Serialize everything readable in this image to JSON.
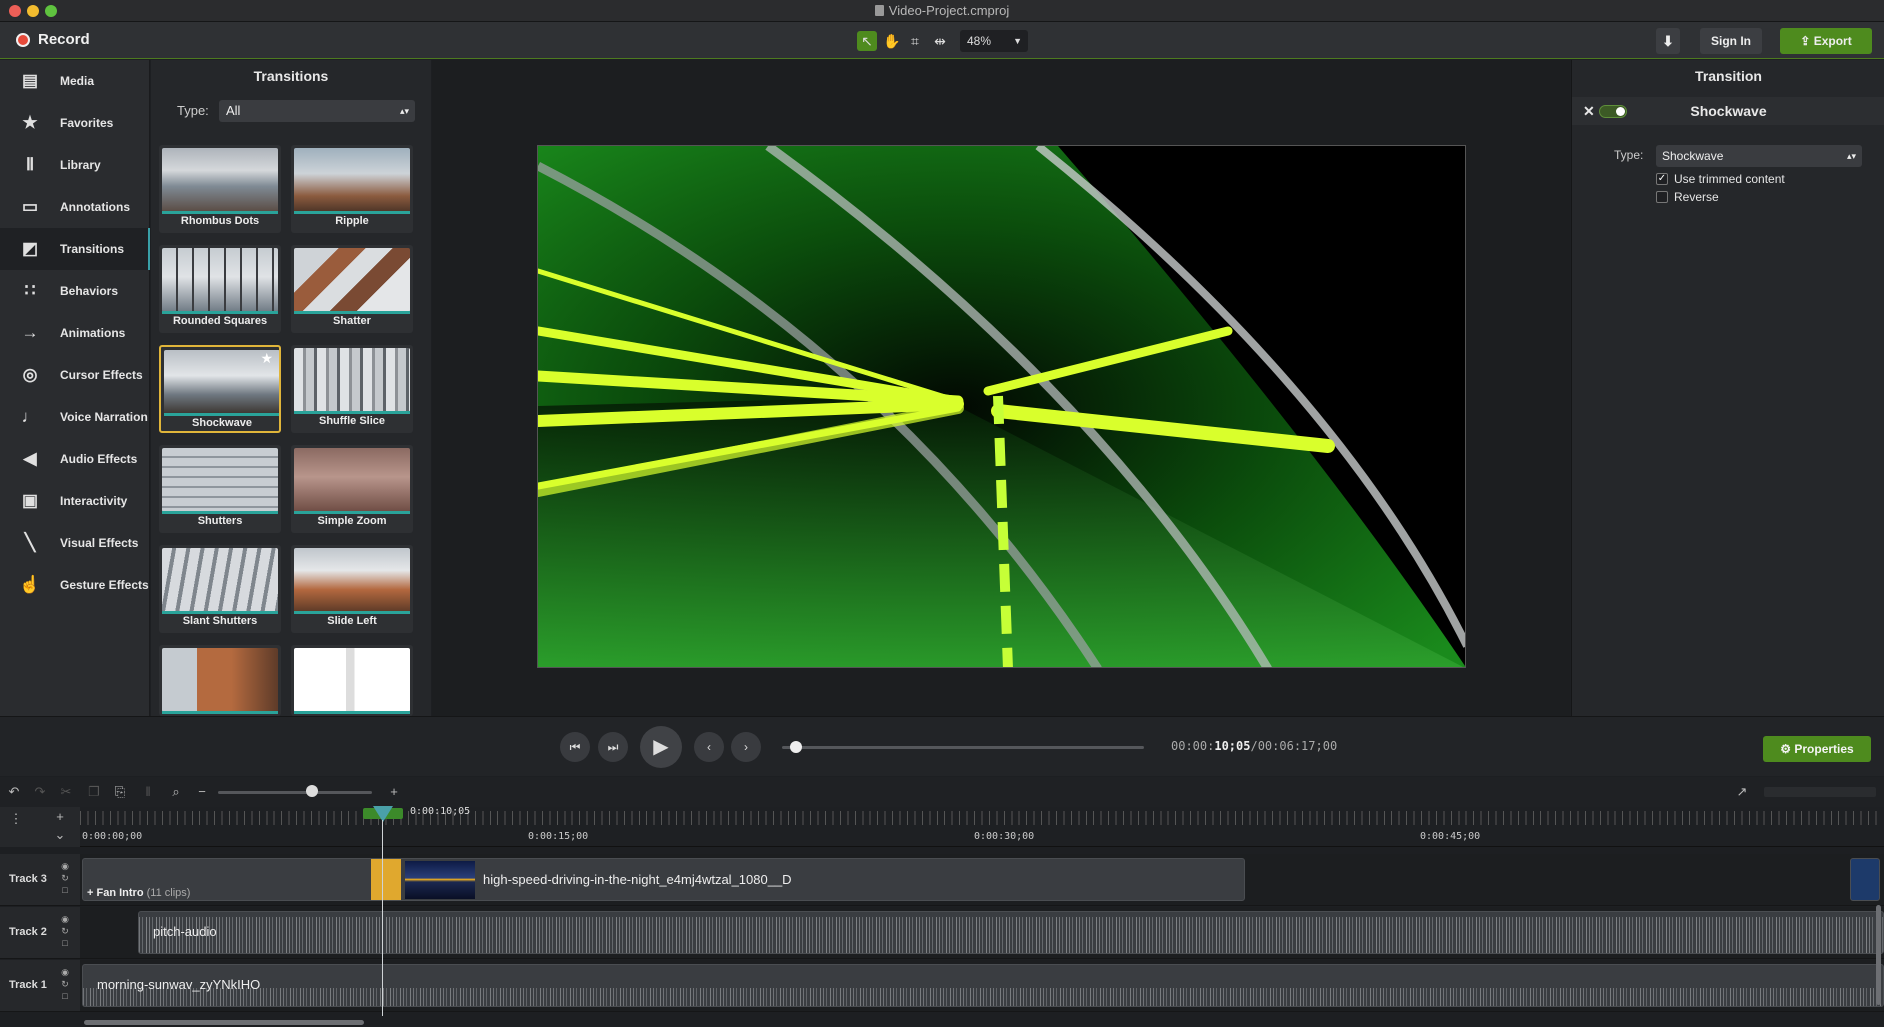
{
  "window": {
    "title": "Video-Project.cmproj"
  },
  "toolbar": {
    "record_label": "Record",
    "zoom": "48%",
    "sign_in": "Sign In",
    "export": "Export"
  },
  "nav": {
    "items": [
      {
        "label": "Media",
        "icon": "film-icon"
      },
      {
        "label": "Favorites",
        "icon": "star-icon"
      },
      {
        "label": "Library",
        "icon": "library-icon"
      },
      {
        "label": "Annotations",
        "icon": "annotation-icon"
      },
      {
        "label": "Transitions",
        "icon": "transition-icon",
        "active": true
      },
      {
        "label": "Behaviors",
        "icon": "behaviors-icon"
      },
      {
        "label": "Animations",
        "icon": "animation-arrow-icon"
      },
      {
        "label": "Cursor Effects",
        "icon": "cursor-icon"
      },
      {
        "label": "Voice Narration",
        "icon": "microphone-icon"
      },
      {
        "label": "Audio Effects",
        "icon": "speaker-icon"
      },
      {
        "label": "Interactivity",
        "icon": "interactivity-icon"
      },
      {
        "label": "Visual Effects",
        "icon": "wand-icon"
      },
      {
        "label": "Gesture Effects",
        "icon": "hand-icon"
      }
    ]
  },
  "transitions": {
    "title": "Transitions",
    "type_label": "Type:",
    "type_value": "All",
    "items": [
      "Rhombus Dots",
      "Ripple",
      "Rounded Squares",
      "Shatter",
      "Shockwave",
      "Shuffle Slice",
      "Shutters",
      "Simple Zoom",
      "Slant Shutters",
      "Slide Left"
    ],
    "selected": "Shockwave"
  },
  "properties": {
    "title": "Transition",
    "name": "Shockwave",
    "type_label": "Type:",
    "type_value": "Shockwave",
    "use_trimmed": "Use trimmed content",
    "reverse": "Reverse",
    "use_trimmed_checked": true,
    "reverse_checked": false
  },
  "playback": {
    "time_prefix": "00:00:",
    "time_current": "10;05",
    "time_total": "/00:06:17;00",
    "properties_btn": "Properties",
    "progress": 0.02
  },
  "timeline": {
    "playhead_time": "0:00:10;05",
    "ruler": [
      "0:00:00;00",
      "0:00:15;00",
      "0:00:30;00",
      "0:00:45;00"
    ],
    "tracks": [
      {
        "name": "Track 3",
        "group_label": "Fan Intro",
        "group_count": "(11 clips)",
        "clip": "high-speed-driving-in-the-night_e4mj4wtzal_1080__D"
      },
      {
        "name": "Track 2",
        "clip": "pitch-audio"
      },
      {
        "name": "Track 1",
        "clip": "morning-sunwav_zyYNkIHO"
      }
    ]
  },
  "colors": {
    "accent_green": "#4e8b1e",
    "selection_gold": "#e0b53a",
    "teal": "#2aa39a",
    "record_red": "#e64a3a"
  }
}
